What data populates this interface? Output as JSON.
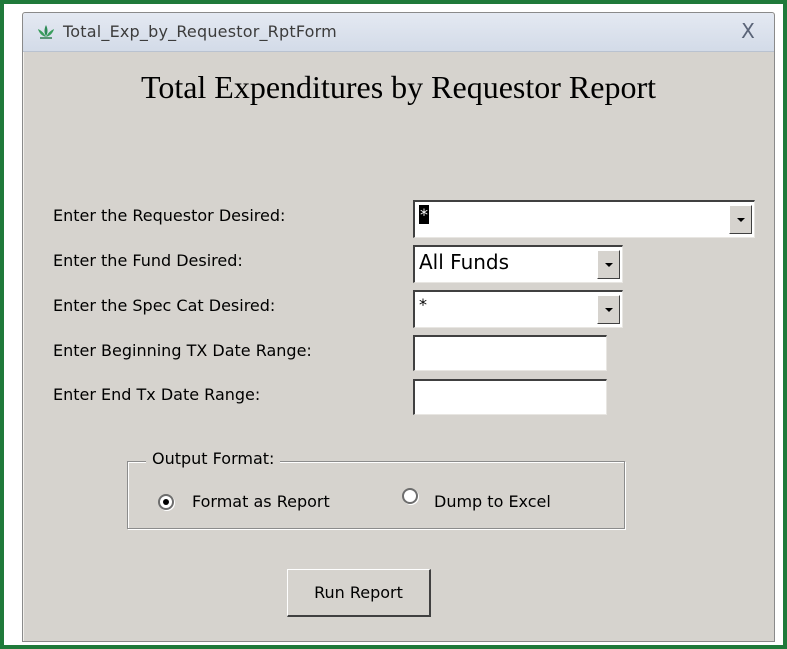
{
  "window": {
    "title": "Total_Exp_by_Requestor_RptForm",
    "close_glyph": "X",
    "icon": "form-icon"
  },
  "form": {
    "heading": "Total Expenditures by Requestor Report",
    "fields": {
      "requestor": {
        "label": "Enter the Requestor Desired:",
        "value": "*"
      },
      "fund": {
        "label": "Enter the Fund Desired:",
        "value": "All Funds"
      },
      "spec_cat": {
        "label": "Enter the Spec Cat Desired:",
        "value": "*"
      },
      "begin_date": {
        "label": "Enter Beginning TX Date Range:",
        "value": ""
      },
      "end_date": {
        "label": "Enter End Tx Date Range:",
        "value": ""
      }
    },
    "output_format": {
      "legend": "Output Format:",
      "options": [
        {
          "label": "Format as Report",
          "selected": true
        },
        {
          "label": "Dump to Excel",
          "selected": false
        }
      ]
    },
    "run_button": "Run Report"
  },
  "colors": {
    "frame_border": "#1f7a3a",
    "form_background": "#d6d3ce",
    "titlebar": "#dde3ee"
  }
}
